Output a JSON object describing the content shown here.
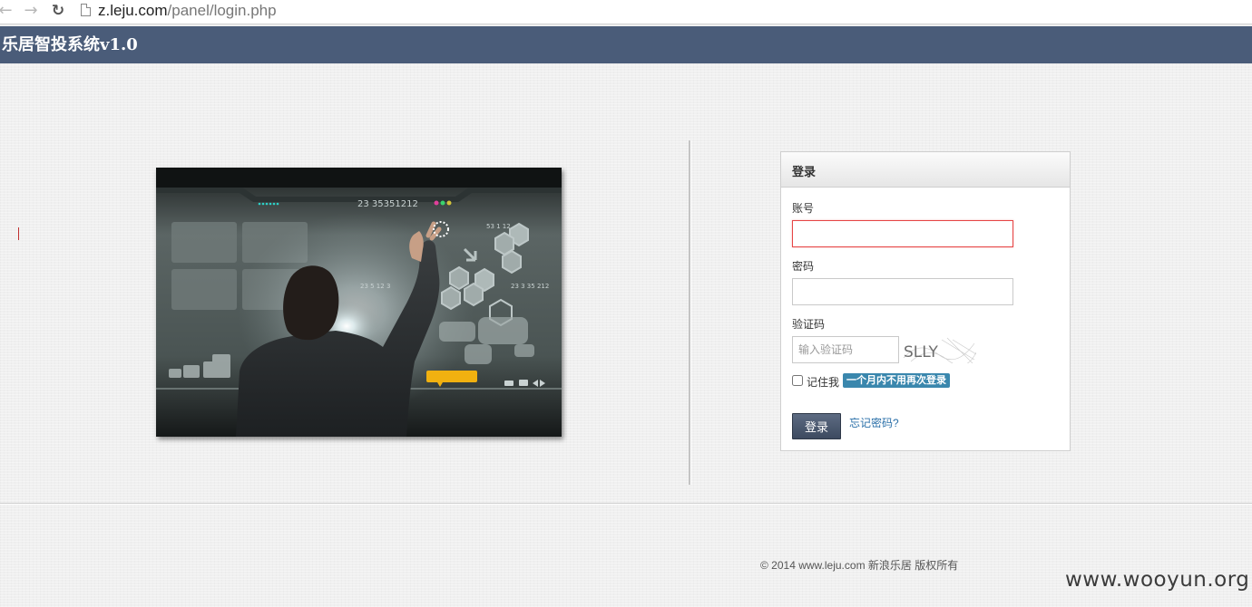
{
  "browser": {
    "url_host": "z.leju.com",
    "url_path": "/panel/login.php"
  },
  "header": {
    "title": "乐居智投系统v1.0"
  },
  "hero": {
    "image_text": "23 35351212",
    "panel_label_1": "53 1 12",
    "panel_label_2": "23 3 35 212",
    "panel_label_3": "23 5 12 3"
  },
  "login": {
    "panel_title": "登录",
    "account_label": "账号",
    "account_value": "",
    "password_label": "密码",
    "password_value": "",
    "captcha_label": "验证码",
    "captcha_placeholder": "输入验证码",
    "captcha_text": "SLLY",
    "remember_label": "记住我",
    "remember_badge": "一个月内不用再次登录",
    "submit_label": "登录",
    "forgot_label": "忘记密码?"
  },
  "footer": {
    "copyright": "© 2014 www.leju.com 新浪乐居 版权所有"
  },
  "watermark": "www.wooyun.org",
  "colors": {
    "header_bg": "#4a5c79",
    "badge_bg": "#3a87ad",
    "focus_border": "#e64545",
    "link": "#2a6fa8"
  }
}
